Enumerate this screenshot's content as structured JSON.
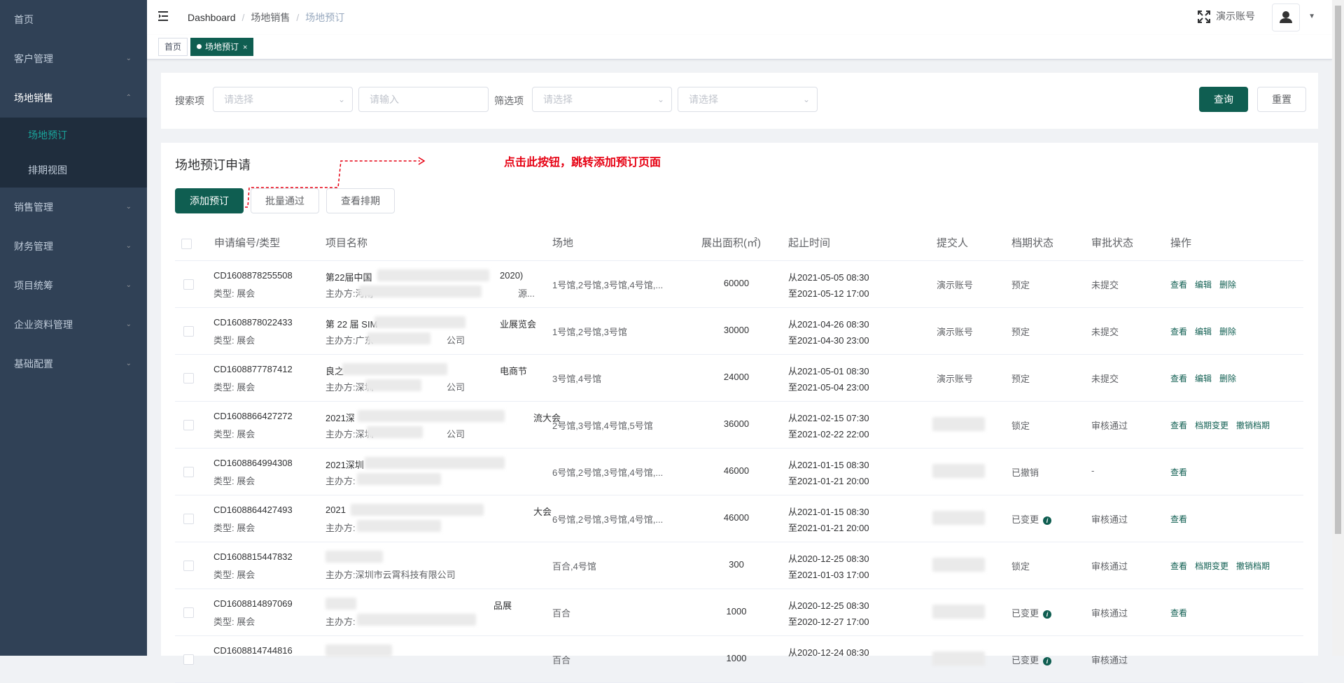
{
  "sidebar": {
    "items": [
      {
        "label": "首页",
        "has_arrow": false
      },
      {
        "label": "客户管理",
        "has_arrow": true
      },
      {
        "label": "场地销售",
        "has_arrow": true,
        "expanded": true,
        "children": [
          {
            "label": "场地预订",
            "active": true
          },
          {
            "label": "排期视图"
          }
        ]
      },
      {
        "label": "销售管理",
        "has_arrow": true
      },
      {
        "label": "财务管理",
        "has_arrow": true
      },
      {
        "label": "项目统筹",
        "has_arrow": true
      },
      {
        "label": "企业资料管理",
        "has_arrow": true
      },
      {
        "label": "基础配置",
        "has_arrow": true
      }
    ]
  },
  "navbar": {
    "breadcrumb": [
      "Dashboard",
      "场地销售",
      "场地预订"
    ],
    "account": "演示账号"
  },
  "tags": [
    {
      "label": "首页",
      "active": false
    },
    {
      "label": "场地预订",
      "active": true,
      "close": "×"
    }
  ],
  "search": {
    "label1": "搜索项",
    "select1_placeholder": "请选择",
    "input_placeholder": "请输入",
    "label2": "筛选项",
    "select2_placeholder": "请选择",
    "select3_placeholder": "请选择",
    "query_button": "查询",
    "reset_button": "重置"
  },
  "list": {
    "title": "场地预订申请",
    "annotation": "点击此按钮，跳转添加预订页面",
    "add_button": "添加预订",
    "batch_button": "批量通过",
    "schedule_button": "查看排期",
    "headers": [
      "申请编号/类型",
      "项目名称",
      "场地",
      "展出面积(㎡)",
      "起止时间",
      "提交人",
      "档期状态",
      "审批状态",
      "操作"
    ],
    "rows": [
      {
        "id": "CD1608878255508",
        "type": "类型: 展会",
        "name": "第22届中国",
        "name_tail": "2020)",
        "org": "主办方:河南",
        "org_tail": "源...",
        "venue": "1号馆,2号馆,3号馆,4号馆,...",
        "area": "60000",
        "start": "从2021-05-05 08:30",
        "end": "至2021-05-12 17:00",
        "submitter": "演示账号",
        "schedule": "预定",
        "schedule_info": false,
        "approval": "未提交",
        "actions": [
          "查看",
          "编辑",
          "删除"
        ]
      },
      {
        "id": "CD1608878022433",
        "type": "类型: 展会",
        "name": "第 22 届 SIM",
        "name_tail": "业展览会",
        "org": "主办方:广东",
        "org_tail": "公司",
        "venue": "1号馆,2号馆,3号馆",
        "area": "30000",
        "start": "从2021-04-26 08:30",
        "end": "至2021-04-30 23:00",
        "submitter": "演示账号",
        "schedule": "预定",
        "schedule_info": false,
        "approval": "未提交",
        "actions": [
          "查看",
          "编辑",
          "删除"
        ]
      },
      {
        "id": "CD1608877787412",
        "type": "类型: 展会",
        "name": "良之",
        "name_tail": "电商节",
        "org": "主办方:深圳",
        "org_tail": "公司",
        "venue": "3号馆,4号馆",
        "area": "24000",
        "start": "从2021-05-01 08:30",
        "end": "至2021-05-04 23:00",
        "submitter": "演示账号",
        "schedule": "预定",
        "schedule_info": false,
        "approval": "未提交",
        "actions": [
          "查看",
          "编辑",
          "删除"
        ]
      },
      {
        "id": "CD1608866427272",
        "type": "类型: 展会",
        "name": "2021深",
        "name_tail": "流大会",
        "org": "主办方:深圳",
        "org_tail": "公司",
        "venue": "2号馆,3号馆,4号馆,5号馆",
        "area": "36000",
        "start": "从2021-02-15 07:30",
        "end": "至2021-02-22 22:00",
        "submitter": "",
        "schedule": "锁定",
        "schedule_info": false,
        "approval": "审核通过",
        "actions": [
          "查看",
          "档期变更",
          "撤销档期"
        ]
      },
      {
        "id": "CD1608864994308",
        "type": "类型: 展会",
        "name": "2021深圳",
        "name_tail": "",
        "org": "主办方:",
        "org_tail": "",
        "venue": "6号馆,2号馆,3号馆,4号馆,...",
        "area": "46000",
        "start": "从2021-01-15 08:30",
        "end": "至2021-01-21 20:00",
        "submitter": "",
        "schedule": "已撤销",
        "schedule_info": false,
        "approval": "-",
        "actions": [
          "查看"
        ]
      },
      {
        "id": "CD1608864427493",
        "type": "类型: 展会",
        "name": "2021",
        "name_tail": "大会",
        "org": "主办方:",
        "org_tail": "",
        "venue": "6号馆,2号馆,3号馆,4号馆,...",
        "area": "46000",
        "start": "从2021-01-15 08:30",
        "end": "至2021-01-21 20:00",
        "submitter": "",
        "schedule": "已变更",
        "schedule_info": true,
        "approval": "审核通过",
        "actions": [
          "查看"
        ]
      },
      {
        "id": "CD1608815447832",
        "type": "类型: 展会",
        "name": "",
        "name_tail": "",
        "org": "主办方:深圳市云霄科技有限公司",
        "org_tail": "",
        "venue": "百合,4号馆",
        "area": "300",
        "start": "从2020-12-25 08:30",
        "end": "至2021-01-03 17:00",
        "submitter": "",
        "schedule": "锁定",
        "schedule_info": false,
        "approval": "审核通过",
        "actions": [
          "查看",
          "档期变更",
          "撤销档期"
        ]
      },
      {
        "id": "CD1608814897069",
        "type": "类型: 展会",
        "name": "",
        "name_tail": "品展",
        "org": "主办方:",
        "org_tail": "",
        "venue": "百合",
        "area": "1000",
        "start": "从2020-12-25 08:30",
        "end": "至2020-12-27 17:00",
        "submitter": "",
        "schedule": "已变更",
        "schedule_info": true,
        "approval": "审核通过",
        "actions": [
          "查看"
        ]
      },
      {
        "id": "CD1608814744816",
        "type": "",
        "name": "",
        "name_tail": "",
        "org": "",
        "org_tail": "",
        "venue": "百合",
        "area": "1000",
        "start": "从2020-12-24 08:30",
        "end": "",
        "submitter": "",
        "schedule": "已变更",
        "schedule_info": true,
        "approval": "审核通过",
        "actions": []
      }
    ]
  },
  "icons": {
    "hamburger": "hamburger-icon",
    "fullscreen": "fullscreen-icon",
    "avatar": "user-icon",
    "chevron": "chevron-down-icon",
    "info": "info-icon"
  },
  "colors": {
    "primary": "#0f5e51",
    "sidebar_bg": "#304156",
    "submenu_bg": "#1f2d3d",
    "active_text": "#1aa39a",
    "annotation_red": "#e60012"
  }
}
